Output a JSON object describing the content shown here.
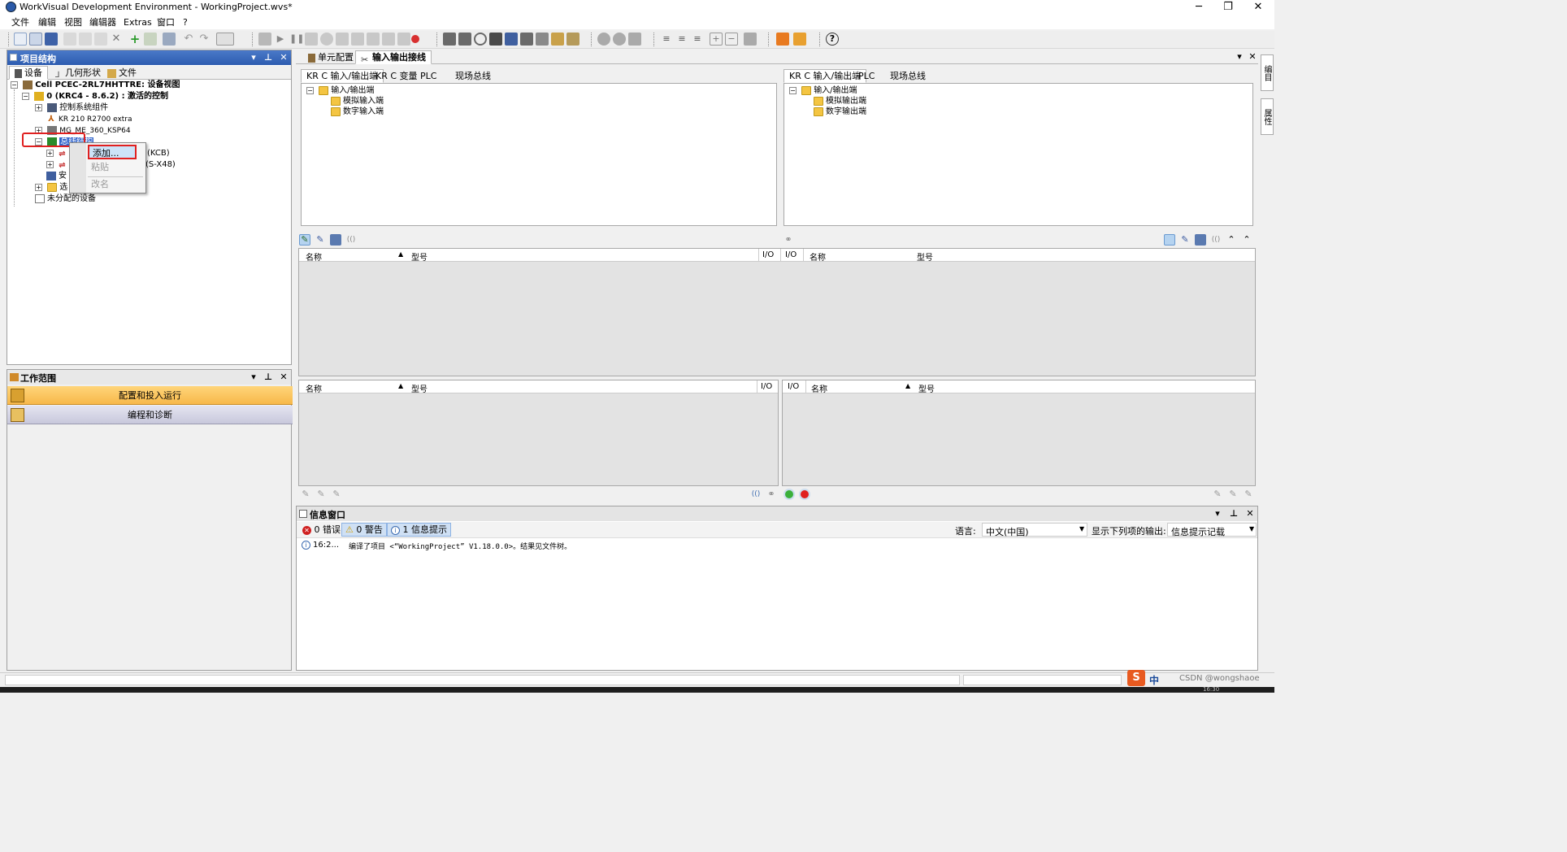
{
  "window": {
    "title": "WorkVisual Development Environment - WorkingProject.wvs*",
    "min": "─",
    "max": "❐",
    "close": "✕"
  },
  "menu": [
    "文件",
    "编辑",
    "视图",
    "编辑器",
    "Extras",
    "窗口",
    "?"
  ],
  "project_panel": {
    "title": "项目结构",
    "tabs": [
      "设备",
      "几何形状",
      "文件"
    ],
    "tree": [
      {
        "label": "Cell PCEC-2RL7HHTTRE: 设备视图",
        "bold": true
      },
      {
        "label": "0 (KRC4 - 8.6.2) : 激活的控制",
        "bold": true
      },
      {
        "label": "控制系统组件"
      },
      {
        "label": "KR 210 R2700 extra"
      },
      {
        "label": "MG_ME_360_KSP64"
      },
      {
        "label": "总线结构"
      },
      {
        "label": "(KCB)"
      },
      {
        "label": "(S-X48)"
      },
      {
        "label": "安"
      },
      {
        "label": "选"
      },
      {
        "label": "未分配的设备"
      }
    ],
    "context_menu": {
      "add": "添加...",
      "paste": "粘贴",
      "rename": "改名"
    }
  },
  "workspace_panel": {
    "title": "工作范围",
    "items": [
      "配置和投入运行",
      "编程和诊断"
    ]
  },
  "doc_tabs": [
    "单元配置",
    "输入输出接线"
  ],
  "io_left": {
    "tabs": [
      "KR C 输入/输出端",
      "KR C 变量",
      "PLC",
      "现场总线"
    ],
    "tree": [
      "输入/输出端",
      "模拟输入端",
      "数字输入端"
    ]
  },
  "io_right": {
    "tabs": [
      "KR C 输入/输出端",
      "PLC",
      "现场总线"
    ],
    "tree": [
      "输入/输出端",
      "模拟输出端",
      "数字输出端"
    ]
  },
  "grid_top": {
    "name": "名称",
    "type": "型号",
    "io": "I/O",
    "io2": "I/O",
    "name2": "名称",
    "type2": "型号"
  },
  "grid_bottom_left": {
    "name": "名称",
    "type": "型号",
    "io": "I/O"
  },
  "grid_bottom_right": {
    "io": "I/O",
    "name": "名称",
    "type": "型号"
  },
  "info_panel": {
    "title": "信息窗口",
    "errors": "0 错误",
    "warnings": "0 警告",
    "infos": "1 信息提示",
    "lang_label": "语言:",
    "lang_value": "中文(中国)",
    "output_label": "显示下列项的输出:",
    "output_value": "信息提示记载",
    "messages": [
      {
        "time": "16:2...",
        "text": "编译了项目 <“WorkingProject” V1.18.0.0>。结果见文件树。"
      }
    ]
  },
  "right_side_tabs": [
    "编目",
    "属性"
  ],
  "taskbar": {
    "ime": "中",
    "watermark": "CSDN @wongshaoe",
    "clock": "16:30"
  },
  "colors": {
    "accent": "#2d5cb0",
    "highlight": "#e02020",
    "workspace_active": "#f7b84a",
    "workspace_inactive": "#cfcfe0"
  }
}
